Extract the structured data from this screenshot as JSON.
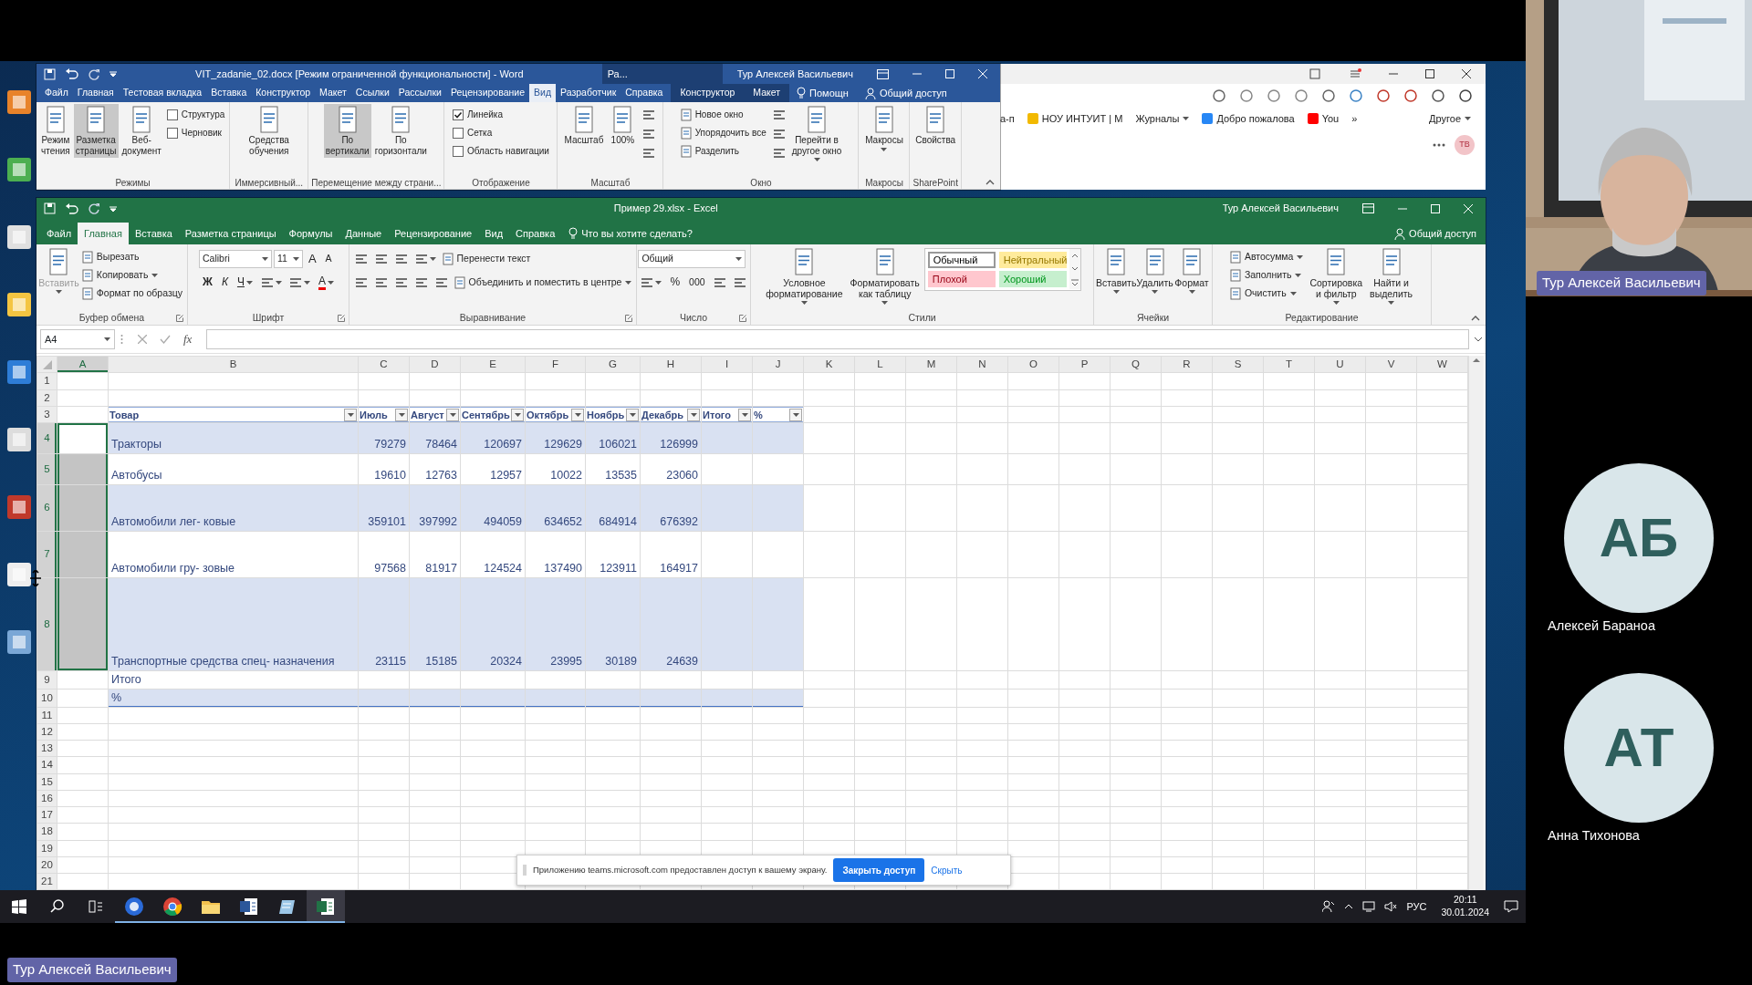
{
  "word": {
    "title": "VIT_zadanie_02.docx [Режим ограниченной функциональности] - Word",
    "context_label": "Ра...",
    "user": "Тур Алексей Васильевич",
    "tabs": [
      {
        "label": "Файл",
        "selected": false
      },
      {
        "label": "Главная",
        "selected": false
      },
      {
        "label": "Тестовая вкладка",
        "selected": false
      },
      {
        "label": "Вставка",
        "selected": false
      },
      {
        "label": "Конструктор",
        "selected": false
      },
      {
        "label": "Макет",
        "selected": false
      },
      {
        "label": "Ссылки",
        "selected": false
      },
      {
        "label": "Рассылки",
        "selected": false
      },
      {
        "label": "Рецензирование",
        "selected": false
      },
      {
        "label": "Вид",
        "selected": true
      },
      {
        "label": "Разработчик",
        "selected": false
      },
      {
        "label": "Справка",
        "selected": false
      }
    ],
    "context_tabs": [
      {
        "label": "Конструктор",
        "selected": false
      },
      {
        "label": "Макет",
        "selected": false
      }
    ],
    "tell_me": "Помощн",
    "share": "Общий доступ",
    "groups": [
      {
        "label": "Режимы",
        "items": [
          {
            "kind": "large",
            "label": "Режим\nчтения",
            "selected": false
          },
          {
            "kind": "large",
            "label": "Разметка\nстраницы",
            "selected": true
          },
          {
            "kind": "large",
            "label": "Веб-\nдокумент",
            "selected": false
          },
          {
            "kind": "stack",
            "items": [
              {
                "kind": "check",
                "label": "Структура",
                "checked": false
              },
              {
                "kind": "check",
                "label": "Черновик",
                "checked": false
              }
            ]
          }
        ]
      },
      {
        "label": "Иммерсивный...",
        "items": [
          {
            "kind": "large",
            "label": "Средства\nобучения",
            "selected": false
          }
        ]
      },
      {
        "label": "Перемещение между страни...",
        "items": [
          {
            "kind": "large",
            "label": "По\nвертикали",
            "selected": true
          },
          {
            "kind": "large",
            "label": "По\nгоризонтали",
            "selected": false
          }
        ]
      },
      {
        "label": "Отображение",
        "items": [
          {
            "kind": "stack",
            "items": [
              {
                "kind": "check",
                "label": "Линейка",
                "checked": true
              },
              {
                "kind": "check",
                "label": "Сетка",
                "checked": false
              },
              {
                "kind": "check",
                "label": "Область навигации",
                "checked": false
              }
            ]
          }
        ]
      },
      {
        "label": "Масштаб",
        "items": [
          {
            "kind": "large",
            "label": "Масштаб",
            "selected": false
          },
          {
            "kind": "large",
            "label": "100%",
            "selected": false
          },
          {
            "kind": "stack",
            "items": [
              {
                "kind": "icon"
              },
              {
                "kind": "icon"
              },
              {
                "kind": "icon"
              }
            ]
          }
        ]
      },
      {
        "label": "Окно",
        "items": [
          {
            "kind": "stack",
            "items": [
              {
                "kind": "small",
                "label": "Новое окно"
              },
              {
                "kind": "small",
                "label": "Упорядочить все"
              },
              {
                "kind": "small",
                "label": "Разделить"
              }
            ]
          },
          {
            "kind": "stack",
            "items": [
              {
                "kind": "icon"
              },
              {
                "kind": "icon"
              },
              {
                "kind": "icon"
              }
            ]
          },
          {
            "kind": "large",
            "label": "Перейти в\nдругое окно",
            "selected": false,
            "dropdown": true
          }
        ]
      },
      {
        "label": "Макросы",
        "items": [
          {
            "kind": "large",
            "label": "Макросы",
            "selected": false,
            "dropdown": true
          }
        ]
      },
      {
        "label": "SharePoint",
        "items": [
          {
            "kind": "large",
            "label": "Свойства",
            "selected": false
          }
        ]
      }
    ]
  },
  "browser": {
    "bookmarks": [
      {
        "label": "а-п"
      },
      {
        "label": "НОУ ИНТУИТ | М",
        "color": "#f2b900"
      },
      {
        "label": "Журналы",
        "dropdown": true
      },
      {
        "label": "Добро пожалова",
        "color": "#2787f5"
      },
      {
        "label": "You",
        "color": "#ff0000"
      }
    ],
    "more": "»",
    "other": "Другое",
    "avatar": "ТВ"
  },
  "excel": {
    "title": "Пример 29.xlsx - Excel",
    "user": "Тур Алексей Васильевич",
    "tabs": [
      {
        "label": "Файл",
        "selected": false
      },
      {
        "label": "Главная",
        "selected": true
      },
      {
        "label": "Вставка",
        "selected": false
      },
      {
        "label": "Разметка страницы",
        "selected": false
      },
      {
        "label": "Формулы",
        "selected": false
      },
      {
        "label": "Данные",
        "selected": false
      },
      {
        "label": "Рецензирование",
        "selected": false
      },
      {
        "label": "Вид",
        "selected": false
      },
      {
        "label": "Справка",
        "selected": false
      }
    ],
    "tell_me": "Что вы хотите сделать?",
    "share": "Общий доступ",
    "groups": [
      {
        "label": "Буфер обмена",
        "launcher": true,
        "items": [
          {
            "kind": "large",
            "label": "Вставить",
            "disabled": true,
            "dropdown": true
          },
          {
            "kind": "stack",
            "items": [
              {
                "kind": "small",
                "label": "Вырезать"
              },
              {
                "kind": "small",
                "label": "Копировать",
                "dropdown": true
              },
              {
                "kind": "small",
                "label": "Формат по образцу"
              }
            ]
          }
        ]
      },
      {
        "label": "Шрифт",
        "launcher": true,
        "items": [
          {
            "kind": "stack",
            "items": [
              {
                "kind": "row",
                "items": [
                  {
                    "kind": "combo",
                    "value": "Calibri"
                  },
                  {
                    "kind": "combo",
                    "value": "11"
                  },
                  {
                    "kind": "glyph-grow",
                    "label": "A"
                  },
                  {
                    "kind": "glyph-shrink",
                    "label": "A"
                  }
                ]
              },
              {
                "kind": "row",
                "items": [
                  {
                    "kind": "glyph-bold",
                    "label": "Ж"
                  },
                  {
                    "kind": "glyph-italic",
                    "label": "К"
                  },
                  {
                    "kind": "glyph-underline",
                    "label": "Ч",
                    "dropdown": true
                  },
                  {
                    "kind": "icon",
                    "dropdown": true
                  },
                  {
                    "kind": "icon",
                    "dropdown": true
                  },
                  {
                    "kind": "glyph-color",
                    "label": "A",
                    "dropdown": true
                  }
                ]
              }
            ]
          }
        ]
      },
      {
        "label": "Выравнивание",
        "launcher": true,
        "items": [
          {
            "kind": "stack",
            "items": [
              {
                "kind": "row",
                "items": [
                  {
                    "kind": "icon"
                  },
                  {
                    "kind": "icon"
                  },
                  {
                    "kind": "icon"
                  },
                  {
                    "kind": "icon",
                    "dropdown": true
                  },
                  {
                    "kind": "small",
                    "label": "Перенести текст"
                  }
                ]
              },
              {
                "kind": "row",
                "items": [
                  {
                    "kind": "icon"
                  },
                  {
                    "kind": "icon"
                  },
                  {
                    "kind": "icon"
                  },
                  {
                    "kind": "icon"
                  },
                  {
                    "kind": "icon"
                  },
                  {
                    "kind": "small",
                    "label": "Объединить и поместить в центре",
                    "dropdown": true
                  }
                ]
              }
            ]
          }
        ]
      },
      {
        "label": "Число",
        "launcher": true,
        "items": [
          {
            "kind": "stack",
            "items": [
              {
                "kind": "row",
                "items": [
                  {
                    "kind": "wide-combo",
                    "value": "Общий"
                  }
                ]
              },
              {
                "kind": "row",
                "items": [
                  {
                    "kind": "icon",
                    "dropdown": true
                  },
                  {
                    "kind": "glyph",
                    "label": "%"
                  },
                  {
                    "kind": "glyph-shrink",
                    "label": "000"
                  },
                  {
                    "kind": "icon"
                  },
                  {
                    "kind": "icon"
                  }
                ]
              }
            ]
          }
        ]
      },
      {
        "label": "Стили",
        "items": [
          {
            "kind": "large",
            "label": "Условное\nформатирование",
            "dropdown": true
          },
          {
            "kind": "large",
            "label": "Форматировать\nкак таблицу",
            "dropdown": true
          },
          {
            "kind": "gallery",
            "items": [
              {
                "label": "Обычный",
                "color": "#ffffff",
                "selected": true
              },
              {
                "label": "Нейтральный",
                "color": "#ffeb9c",
                "selected": false
              },
              {
                "label": "Плохой",
                "color": "#ffc7ce",
                "selected": false
              },
              {
                "label": "Хороший",
                "color": "#c6efce",
                "selected": false
              }
            ]
          }
        ]
      },
      {
        "label": "Ячейки",
        "items": [
          {
            "kind": "large",
            "label": "Вставить",
            "dropdown": true
          },
          {
            "kind": "large",
            "label": "Удалить",
            "dropdown": true
          },
          {
            "kind": "large",
            "label": "Формат",
            "dropdown": true
          }
        ]
      },
      {
        "label": "Редактирование",
        "items": [
          {
            "kind": "stack",
            "items": [
              {
                "kind": "small",
                "label": "Автосумма",
                "dropdown": true
              },
              {
                "kind": "small",
                "label": "Заполнить",
                "dropdown": true
              },
              {
                "kind": "small",
                "label": "Очистить",
                "dropdown": true
              }
            ]
          },
          {
            "kind": "large",
            "label": "Сортировка\nи фильтр",
            "dropdown": true
          },
          {
            "kind": "large",
            "label": "Найти и\nвыделить",
            "dropdown": true
          }
        ]
      }
    ],
    "name_box": "A4",
    "function_label": "fx",
    "sheet": {
      "column_headers": [
        {
          "label": "A",
          "selected": true
        },
        {
          "label": "B",
          "selected": false
        },
        {
          "label": "C",
          "selected": false
        },
        {
          "label": "D",
          "selected": false
        },
        {
          "label": "E",
          "selected": false
        },
        {
          "label": "F",
          "selected": false
        },
        {
          "label": "G",
          "selected": false
        },
        {
          "label": "H",
          "selected": false
        },
        {
          "label": "I",
          "selected": false
        },
        {
          "label": "J",
          "selected": false
        },
        {
          "label": "K",
          "selected": false
        },
        {
          "label": "L",
          "selected": false
        },
        {
          "label": "M",
          "selected": false
        },
        {
          "label": "N",
          "selected": false
        },
        {
          "label": "O",
          "selected": false
        },
        {
          "label": "P",
          "selected": false
        },
        {
          "label": "Q",
          "selected": false
        },
        {
          "label": "R",
          "selected": false
        },
        {
          "label": "S",
          "selected": false
        },
        {
          "label": "T",
          "selected": false
        },
        {
          "label": "U",
          "selected": false
        },
        {
          "label": "V",
          "selected": false
        },
        {
          "label": "W",
          "selected": false
        }
      ],
      "row_headers": [
        {
          "label": "1",
          "selected": false
        },
        {
          "label": "2",
          "selected": false
        },
        {
          "label": "3",
          "selected": false
        },
        {
          "label": "4",
          "selected": true
        },
        {
          "label": "5",
          "selected": true
        },
        {
          "label": "6",
          "selected": true
        },
        {
          "label": "7",
          "selected": true
        },
        {
          "label": "8",
          "selected": true
        },
        {
          "label": "9",
          "selected": false
        },
        {
          "label": "10",
          "selected": false
        },
        {
          "label": "11",
          "selected": false
        },
        {
          "label": "12",
          "selected": false
        },
        {
          "label": "13",
          "selected": false
        },
        {
          "label": "14",
          "selected": false
        },
        {
          "label": "15",
          "selected": false
        },
        {
          "label": "16",
          "selected": false
        },
        {
          "label": "17",
          "selected": false
        },
        {
          "label": "18",
          "selected": false
        },
        {
          "label": "19",
          "selected": false
        },
        {
          "label": "20",
          "selected": false
        },
        {
          "label": "21",
          "selected": false
        }
      ],
      "table": {
        "header": [
          "Товар",
          "Июль",
          "Август",
          "Сентябрь",
          "Октябрь",
          "Ноябрь",
          "Декабрь",
          "Итого",
          "%"
        ],
        "rows": [
          [
            "Тракторы",
            "79279",
            "78464",
            "120697",
            "129629",
            "106021",
            "126999"
          ],
          [
            "Автобусы",
            "19610",
            "12763",
            "12957",
            "10022",
            "13535",
            "23060"
          ],
          [
            "Автомобили лег- ковые",
            "359101",
            "397992",
            "494059",
            "634652",
            "684914",
            "676392"
          ],
          [
            "Автомобили гру- зовые",
            "97568",
            "81917",
            "124524",
            "137490",
            "123911",
            "164917"
          ],
          [
            "Транспортные средства спец- назначения",
            "23115",
            "15185",
            "20324",
            "23995",
            "30189",
            "24639"
          ],
          [
            "Итого"
          ],
          [
            "%"
          ]
        ]
      }
    }
  },
  "share_bar": {
    "message": "Приложению teams.microsoft.com предоставлен доступ к вашему экрану.",
    "stop_button": "Закрыть доступ",
    "hide_link": "Скрыть"
  },
  "taskbar": {
    "apps": [
      {
        "kind": "yandex",
        "running": true,
        "active": false
      },
      {
        "kind": "chrome",
        "running": true,
        "active": false
      },
      {
        "kind": "folder",
        "running": true,
        "active": false
      },
      {
        "kind": "word",
        "running": true,
        "active": false
      },
      {
        "kind": "notes",
        "running": true,
        "active": false
      },
      {
        "kind": "excel",
        "running": true,
        "active": true
      }
    ],
    "language": "РУС",
    "time": "20:11",
    "date": "30.01.2024"
  },
  "participants": {
    "presenter": {
      "name": "Тур Алексей Васильевич",
      "kind": "picture"
    },
    "others": [
      {
        "initials": "АБ",
        "name": "Алексей Бараноа"
      },
      {
        "initials": "АТ",
        "name": "Анна Тихонова"
      }
    ]
  },
  "presenter_tag": "Тур Алексей Васильевич"
}
